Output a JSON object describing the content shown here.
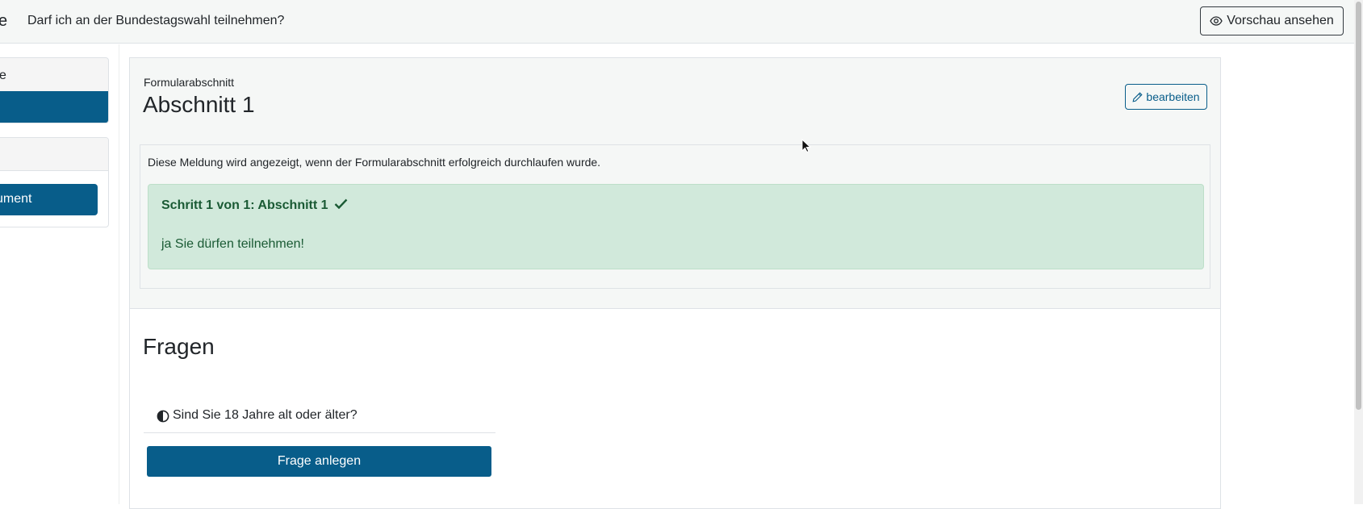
{
  "header": {
    "brand_fragment": "e",
    "title": "Darf ich an der Bundestagswahl teilnehmen?",
    "preview_label": "Vorschau ansehen"
  },
  "sidebar": {
    "card1_label_fragment": "e",
    "card2_button_fragment": "ument"
  },
  "section": {
    "subtitle": "Formularabschnitt",
    "title": "Abschnitt 1",
    "edit_label": "bearbeiten",
    "message": "Diese Meldung wird angezeigt, wenn der Formularabschnitt erfolgreich durchlaufen wurde.",
    "alert_title": "Schritt 1 von 1: Abschnitt 1",
    "alert_text": "ja Sie dürfen teilnehmen!"
  },
  "questions": {
    "heading": "Fragen",
    "items": [
      {
        "label": "Sind Sie 18 Jahre alt oder älter?"
      }
    ],
    "add_label": "Frage anlegen"
  },
  "colors": {
    "primary": "#085d8a",
    "success_bg": "#d1e9db",
    "success_text": "#1a5a34"
  }
}
